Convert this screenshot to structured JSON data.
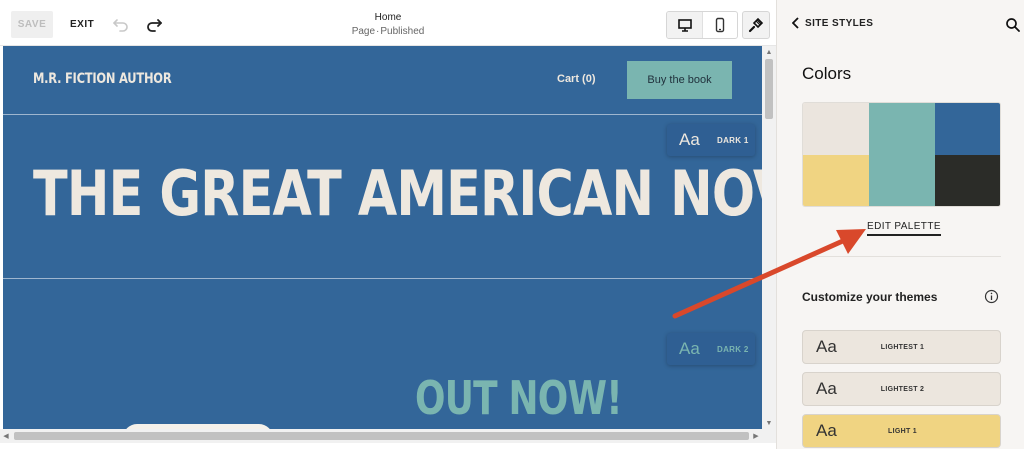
{
  "toolbar": {
    "save_label": "SAVE",
    "exit_label": "EXIT",
    "page_title": "Home",
    "page_type": "Page",
    "separator": "·",
    "page_status": "Published",
    "icons": [
      "undo-icon",
      "redo-icon",
      "desktop-icon",
      "mobile-icon",
      "paint-brush-icon"
    ]
  },
  "site": {
    "name": "M.R. FICTION AUTHOR",
    "cart_label": "Cart (0)",
    "buy_label": "Buy the book",
    "hero_title": "THE GREAT AMERICAN NOVEL",
    "out_now": "OUT NOW!",
    "badge1": {
      "aa": "Aa",
      "label": "DARK 1"
    },
    "badge2": {
      "aa": "Aa",
      "label": "DARK 2"
    },
    "colors": {
      "background": "#336699",
      "text": "#eee8df",
      "accent": "#7ab5b0"
    }
  },
  "panel": {
    "back_label": "SITE STYLES",
    "colors_heading": "Colors",
    "palette": [
      "#ebe5de",
      "#f0d482",
      "#7ab5b0",
      "#336699",
      "#2b2c28"
    ],
    "edit_palette_label": "EDIT PALETTE",
    "customize_heading": "Customize your themes",
    "themes": [
      {
        "aa": "Aa",
        "label": "LIGHTEST 1",
        "color": "#ece6de"
      },
      {
        "aa": "Aa",
        "label": "LIGHTEST 2",
        "color": "#ece6de"
      },
      {
        "aa": "Aa",
        "label": "LIGHT 1",
        "color": "#f0d482"
      }
    ],
    "annotation_color": "#d9482b"
  }
}
